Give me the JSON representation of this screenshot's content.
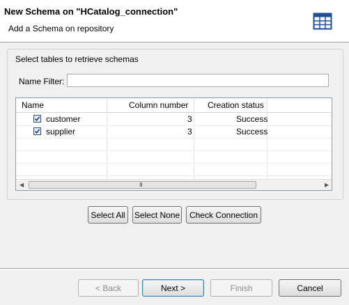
{
  "header": {
    "title": "New Schema on \"HCatalog_connection\"",
    "subtitle": "Add a Schema on repository",
    "icon": "table-grid-icon"
  },
  "group": {
    "label": "Select tables to retrieve schemas"
  },
  "filter": {
    "label": "Name Filter:",
    "value": ""
  },
  "table": {
    "columns": [
      "Name",
      "Column number",
      "Creation status"
    ],
    "rows": [
      {
        "name": "customer",
        "checked": true,
        "column_number": "3",
        "status": "Success"
      },
      {
        "name": "supplier",
        "checked": true,
        "column_number": "3",
        "status": "Success"
      }
    ],
    "scroll_grip": "III"
  },
  "actions": {
    "select_all": "Select All",
    "select_none": "Select None",
    "check_connection": "Check Connection"
  },
  "footer": {
    "back": "< Back",
    "next": "Next >",
    "finish": "Finish",
    "cancel": "Cancel"
  },
  "colors": {
    "accent": "#3c7fb1",
    "icon_blue": "#1f4e9a"
  }
}
